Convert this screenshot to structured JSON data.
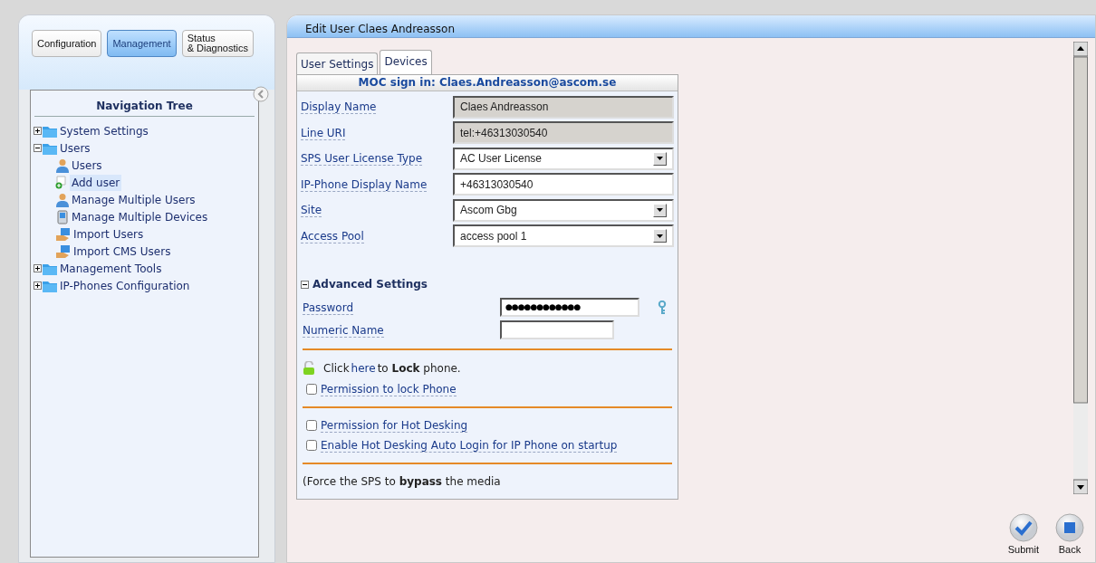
{
  "top_tabs": [
    {
      "label": "Configuration",
      "selected": false
    },
    {
      "label": "Management",
      "selected": true
    },
    {
      "label": "Status\n& Diagnostics",
      "selected": false
    }
  ],
  "nav_tree": {
    "title": "Navigation Tree",
    "items": [
      {
        "label": "System Settings",
        "kind": "folder",
        "expanded": false,
        "selected": false
      },
      {
        "label": "Users",
        "kind": "folder",
        "expanded": true,
        "selected": false,
        "children": [
          {
            "label": "Users",
            "kind": "user",
            "selected": false
          },
          {
            "label": "Add user",
            "kind": "add",
            "selected": true
          },
          {
            "label": "Manage Multiple Users",
            "kind": "user",
            "selected": false
          },
          {
            "label": "Manage Multiple Devices",
            "kind": "device",
            "selected": false
          },
          {
            "label": "Import Users",
            "kind": "import",
            "selected": false
          },
          {
            "label": "Import CMS Users",
            "kind": "import",
            "selected": false
          }
        ]
      },
      {
        "label": "Management Tools",
        "kind": "folder",
        "expanded": false,
        "selected": false
      },
      {
        "label": "IP-Phones Configuration",
        "kind": "folder",
        "expanded": false,
        "selected": false
      }
    ]
  },
  "panel": {
    "title": "Edit User Claes Andreasson"
  },
  "tabs": [
    {
      "label": "User Settings",
      "selected": false
    },
    {
      "label": "Devices",
      "selected": true
    }
  ],
  "form": {
    "header": "MOC sign in: Claes.Andreasson@ascom.se",
    "fields": [
      {
        "label": "Display Name",
        "kind": "text",
        "value": "Claes Andreasson",
        "disabled": true
      },
      {
        "label": "Line URI",
        "kind": "text",
        "value": "tel:+46313030540",
        "disabled": true
      },
      {
        "label": "SPS User License Type",
        "kind": "select",
        "value": "AC User License",
        "disabled": false
      },
      {
        "label": "IP-Phone Display Name",
        "kind": "text",
        "value": "+46313030540",
        "disabled": false
      },
      {
        "label": "Site",
        "kind": "select",
        "value": "Ascom Gbg",
        "disabled": false
      },
      {
        "label": "Access Pool",
        "kind": "select",
        "value": "access pool 1",
        "disabled": false
      }
    ],
    "advanced": {
      "title": "Advanced Settings",
      "expanded": true,
      "fields": [
        {
          "label": "Password",
          "kind": "password",
          "value": "●●●●●●●●●●●●"
        },
        {
          "label": "Numeric Name",
          "kind": "text"
        }
      ]
    },
    "lock": {
      "prefix": "Click",
      "link": "here",
      "suffix": "to **Lock** phone."
    },
    "checkbox_groups": [
      [
        {
          "label": "Permission to lock Phone",
          "checked": false
        }
      ],
      [
        {
          "label": "Permission for Hot Desking",
          "checked": false
        },
        {
          "label": "Enable Hot Desking Auto Login for IP Phone on startup",
          "checked": false
        }
      ]
    ],
    "note": "(Force the SPS to **bypass** the media"
  },
  "actions": [
    {
      "label": "Submit",
      "kind": "submit"
    },
    {
      "label": "Back",
      "kind": "back"
    }
  ]
}
